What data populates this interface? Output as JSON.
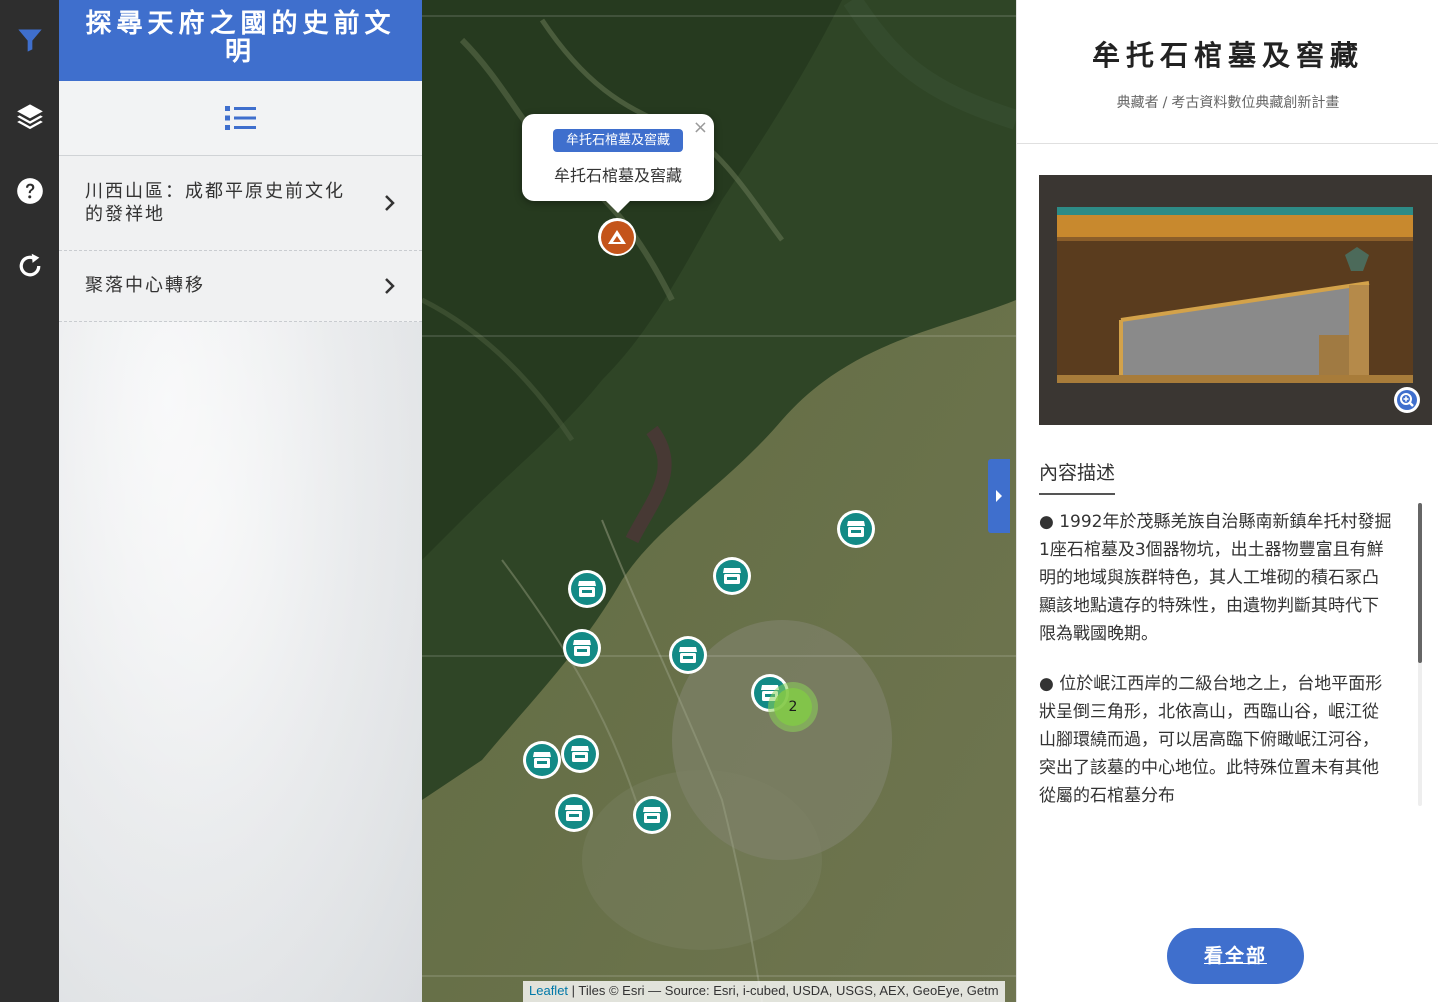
{
  "rail": {
    "icons": [
      "filter-icon",
      "layers-icon",
      "help-icon",
      "refresh-icon"
    ],
    "active_color": "#3f6fcd"
  },
  "story": {
    "title": "探尋天府之國的史前文明",
    "items": [
      {
        "label": "川西山區：成都平原史前文化的發祥地"
      },
      {
        "label": "聚落中心轉移"
      }
    ]
  },
  "map": {
    "popup": {
      "badge": "牟托石棺墓及窖藏",
      "text": "牟托石棺墓及窖藏",
      "close": "×"
    },
    "cluster_count": "2",
    "attribution": {
      "link": "Leaflet",
      "text": " | Tiles © Esri — Source: Esri, i-cubed, USDA, USGS, AEX, GeoEye, Getm"
    }
  },
  "detail": {
    "title": "牟托石棺墓及窖藏",
    "breadcrumb": {
      "owner_label": "典藏者",
      "separator": "/",
      "owner": "考古資料數位典藏創新計畫"
    },
    "desc_heading": "內容描述",
    "paragraphs": [
      "● 1992年於茂縣羌族自治縣南新鎮牟托村發掘1座石棺墓及3個器物坑，出土器物豐富且有鮮明的地域與族群特色，其人工堆砌的積石冢凸顯該地點遺存的特殊性，由遺物判斷其時代下限為戰國晚期。",
      "● 位於岷江西岸的二級台地之上，台地平面形狀呈倒三角形，北依高山，西臨山谷，岷江從山腳環繞而過，可以居高臨下俯瞰岷江河谷，突出了該墓的中心地位。此特殊位置未有其他從屬的石棺墓分布"
    ],
    "see_all": "看全部"
  }
}
